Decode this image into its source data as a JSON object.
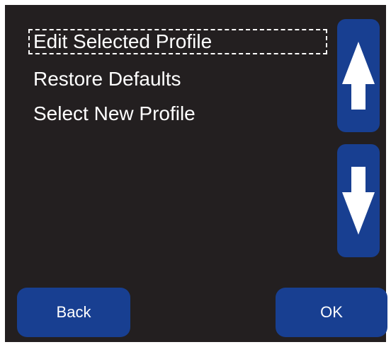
{
  "menu": {
    "items": [
      {
        "label": "Edit Selected Profile",
        "selected": true
      },
      {
        "label": "Restore Defaults",
        "selected": false
      },
      {
        "label": "Select New Profile",
        "selected": false
      }
    ]
  },
  "scroll": {
    "up_icon": "arrow-up-icon",
    "down_icon": "arrow-down-icon"
  },
  "actions": {
    "back_label": "Back",
    "ok_label": "OK"
  },
  "colors": {
    "screen_background": "#231f20",
    "button_blue": "#183f91",
    "text": "#ffffff"
  }
}
